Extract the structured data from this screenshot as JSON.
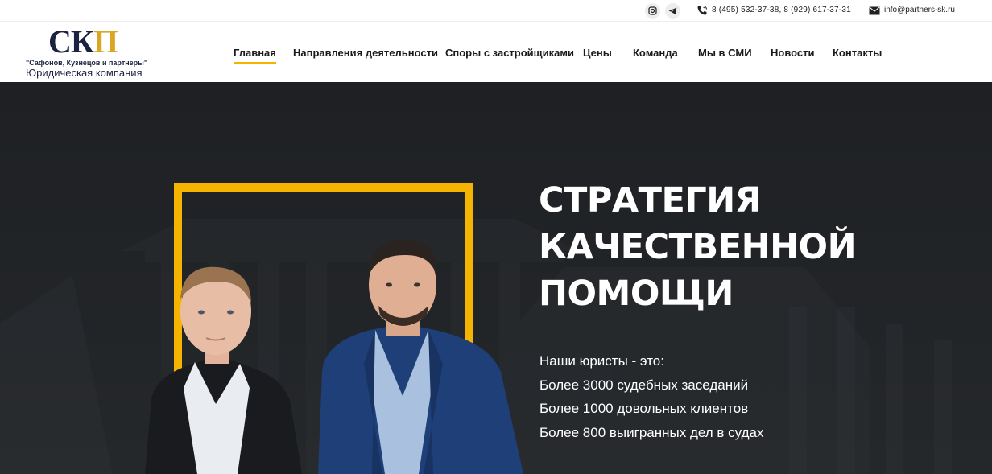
{
  "topbar": {
    "social": [
      {
        "icon": "instagram-icon"
      },
      {
        "icon": "telegram-icon"
      }
    ],
    "phones": "8 (495) 532-37-38, 8 (929) 617-37-31",
    "email": "info@partners-sk.ru"
  },
  "logo": {
    "mark_letters": "СК",
    "mark_accent": "П",
    "firm_name": "\"Сафонов, Кузнецов и партнеры\"",
    "tagline": "Юридическая компания"
  },
  "nav": {
    "items": [
      {
        "label": "Главная",
        "active": true
      },
      {
        "label": "Направления деятельности",
        "active": false
      },
      {
        "label": "Споры с застройщиками",
        "active": false
      },
      {
        "label": "Цены",
        "active": false
      },
      {
        "label": "Команда",
        "active": false
      },
      {
        "label": "Мы в СМИ",
        "active": false
      },
      {
        "label": "Новости",
        "active": false
      },
      {
        "label": "Контакты",
        "active": false
      }
    ]
  },
  "hero": {
    "title_lines": [
      "СТРАТЕГИЯ",
      "КАЧЕСТВЕННОЙ",
      "ПОМОЩИ"
    ],
    "intro": "Наши юристы - это:",
    "facts": [
      "Более 3000 судебных заседаний",
      "Более 1000 довольных клиентов",
      "Более 800 выигранных дел в судах"
    ]
  },
  "colors": {
    "accent": "#f5b400",
    "hero_bg": "#1e2023",
    "brand_navy": "#1b2340"
  }
}
